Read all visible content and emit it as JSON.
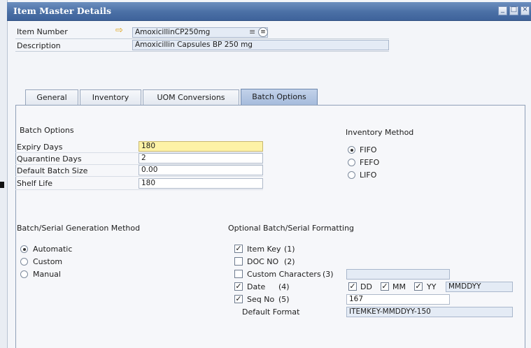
{
  "window": {
    "title": "Item Master Details"
  },
  "header": {
    "item_number_label": "Item Number",
    "item_number_value": "AmoxicillinCP250mg",
    "description_label": "Description",
    "description_value": "Amoxicillin Capsules BP 250 mg"
  },
  "tabs": [
    {
      "label": "General",
      "active": false
    },
    {
      "label": "Inventory",
      "active": false
    },
    {
      "label": "UOM Conversions",
      "active": false
    },
    {
      "label": "Batch Options",
      "active": true
    }
  ],
  "batch_options": {
    "title": "Batch Options",
    "rows": [
      {
        "label": "Expiry Days",
        "value": "180"
      },
      {
        "label": "Quarantine Days",
        "value": "2"
      },
      {
        "label": "Default Batch Size",
        "value": "0.00"
      },
      {
        "label": "Shelf Life",
        "value": "180"
      }
    ]
  },
  "inventory_method": {
    "title": "Inventory Method",
    "options": [
      "FIFO",
      "FEFO",
      "LIFO"
    ],
    "selected": "FIFO"
  },
  "generation_method": {
    "title": "Batch/Serial Generation Method",
    "options": [
      "Automatic",
      "Custom",
      "Manual"
    ],
    "selected": "Automatic"
  },
  "formatting": {
    "title": "Optional Batch/Serial Formatting",
    "item_key": {
      "label": "Item Key",
      "num": "(1)",
      "checked": true
    },
    "doc_no": {
      "label": "DOC NO",
      "num": "(2)",
      "checked": false
    },
    "custom_chars": {
      "label": "Custom Characters",
      "num": "(3)",
      "checked": false,
      "value": ""
    },
    "date": {
      "label": "Date",
      "num": "(4)",
      "checked": true,
      "dd_label": "DD",
      "mm_label": "MM",
      "yy_label": "YY",
      "dd": true,
      "mm": true,
      "yy": true,
      "format_value": "MMDDYY"
    },
    "seq_no": {
      "label": "Seq No",
      "num": "(5)",
      "checked": true,
      "value": "167"
    },
    "default_format_label": "Default Format",
    "default_format_value": "ITEMKEY-MMDDYY-150"
  },
  "icons": {
    "link_arrow": "⇨",
    "list_icon": "≡",
    "checkmark": "✓"
  },
  "colors": {
    "title_bar": "#4a6fa5",
    "active_tab": "#a6bcdc",
    "highlight_field": "#fdf2a6"
  }
}
